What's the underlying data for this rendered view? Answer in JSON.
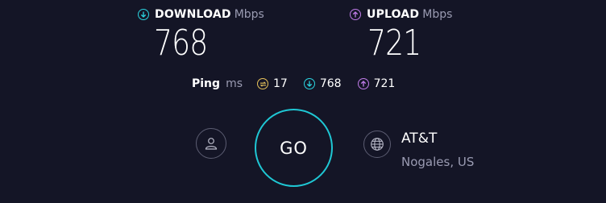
{
  "download": {
    "label": "DOWNLOAD",
    "unit": "Mbps",
    "value": "768",
    "icon": "download-arrow-icon",
    "color": "#2bd4e0"
  },
  "upload": {
    "label": "UPLOAD",
    "unit": "Mbps",
    "value": "721",
    "icon": "upload-arrow-icon",
    "color": "#c07ce8"
  },
  "ping": {
    "label": "Ping",
    "unit": "ms",
    "idle": {
      "icon": "ping-idle-icon",
      "value": "17",
      "color": "#e8c35a"
    },
    "download": {
      "icon": "download-arrow-icon",
      "value": "768",
      "color": "#2bd4e0"
    },
    "upload": {
      "icon": "upload-arrow-icon",
      "value": "721",
      "color": "#c07ce8"
    }
  },
  "actions": {
    "go_label": "GO",
    "user_icon": "user-icon",
    "globe_icon": "globe-icon"
  },
  "isp": {
    "name": "AT&T",
    "location": "Nogales, US"
  }
}
